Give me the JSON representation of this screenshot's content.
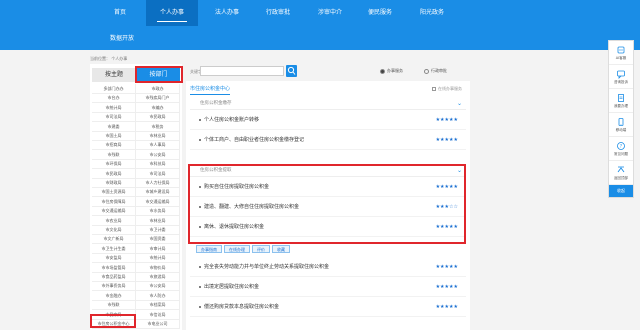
{
  "nav": {
    "row1": [
      "首页",
      "个人办事",
      "法人办事",
      "行政审批",
      "涉审中介",
      "便民服务",
      "阳光政务"
    ],
    "row2": [
      "数据开放"
    ],
    "active": "个人办事"
  },
  "breadcrumb": "当前位置： 个人办事",
  "left": {
    "tabs": [
      "按主题",
      "按部门"
    ],
    "depts": [
      [
        "多部门办办",
        "市政办"
      ],
      [
        "市台办",
        "市残疾局门户"
      ],
      [
        "市统计局",
        "市编办"
      ],
      [
        "市司法局",
        "市民政局"
      ],
      [
        "市建委",
        "市税务"
      ],
      [
        "市国土局",
        "市林业局"
      ],
      [
        "市招商局",
        "市人事局"
      ],
      [
        "市残联",
        "市公安局"
      ],
      [
        "市环保局",
        "市科技局"
      ],
      [
        "市民政局",
        "市司法局"
      ],
      [
        "市财政局",
        "市人力社保局"
      ],
      [
        "市国土资源局",
        "市城乡建设局"
      ],
      [
        "市住房保障局",
        "市交通运输局"
      ],
      [
        "市交通运输局",
        "市水务局"
      ],
      [
        "市农业局",
        "市林业局"
      ],
      [
        "市文化局",
        "市卫计委"
      ],
      [
        "市文广新局",
        "市国资委"
      ],
      [
        "市卫生计生委",
        "市审计局"
      ],
      [
        "市安监局",
        "市统计局"
      ],
      [
        "市市场监管局",
        "市物价局"
      ],
      [
        "市食品药监局",
        "市旅游局"
      ],
      [
        "市外事侨务局",
        "市公安局"
      ],
      [
        "市金融办",
        "市人防办"
      ],
      [
        "市残联",
        "市档案局"
      ],
      [
        "市民宗局",
        "市信访局"
      ],
      [
        "市住房公积金中心",
        "市电业公司"
      ]
    ]
  },
  "search": {
    "label": "关键字：",
    "placeholder": "",
    "radio1": "办事服务",
    "radio2": "行政审批"
  },
  "center": {
    "tab": "市住房公积金中心",
    "checkbox": "在线办事服务",
    "sections": [
      {
        "title": "住房公积金缴存",
        "items": [
          {
            "name": "个人住房公积金账户转移",
            "stars": "★★★★★"
          },
          {
            "name": "个体工商户、自由职业者住房公积金缴存登记",
            "stars": "★★★★★"
          }
        ]
      },
      {
        "title": "住房公积金提取",
        "items": [
          {
            "name": "购买自住住房提取住房公积金",
            "stars": "★★★★★"
          },
          {
            "name": "建造、翻建、大修自住住房提取住房公积金",
            "stars": "★★★☆☆"
          },
          {
            "name": "离休、退休提取住房公积金",
            "stars": "★★★★★"
          }
        ]
      },
      {
        "title": "",
        "items": [
          {
            "name": "完全丧失劳动能力并与单位终止劳动关系提取住房公积金",
            "stars": "★★★★★"
          },
          {
            "name": "出境定居提取住房公积金",
            "stars": "★★★★★"
          },
          {
            "name": "偿还购房贷款本息提取住房公积金",
            "stars": "★★★★★"
          }
        ]
      }
    ],
    "actions": [
      "办事指南",
      "在线办理",
      "评价",
      "收藏"
    ]
  },
  "sidebar": {
    "items": [
      "AI客服",
      "咨询投诉",
      "我要办理",
      "移动端",
      "常见问题",
      "返回顶部"
    ],
    "back": "收起"
  },
  "colors": {
    "primary": "#1a8de6",
    "nav_active": "#0b6fc2",
    "highlight": "#e0262c",
    "star": "#1a6fd1"
  }
}
